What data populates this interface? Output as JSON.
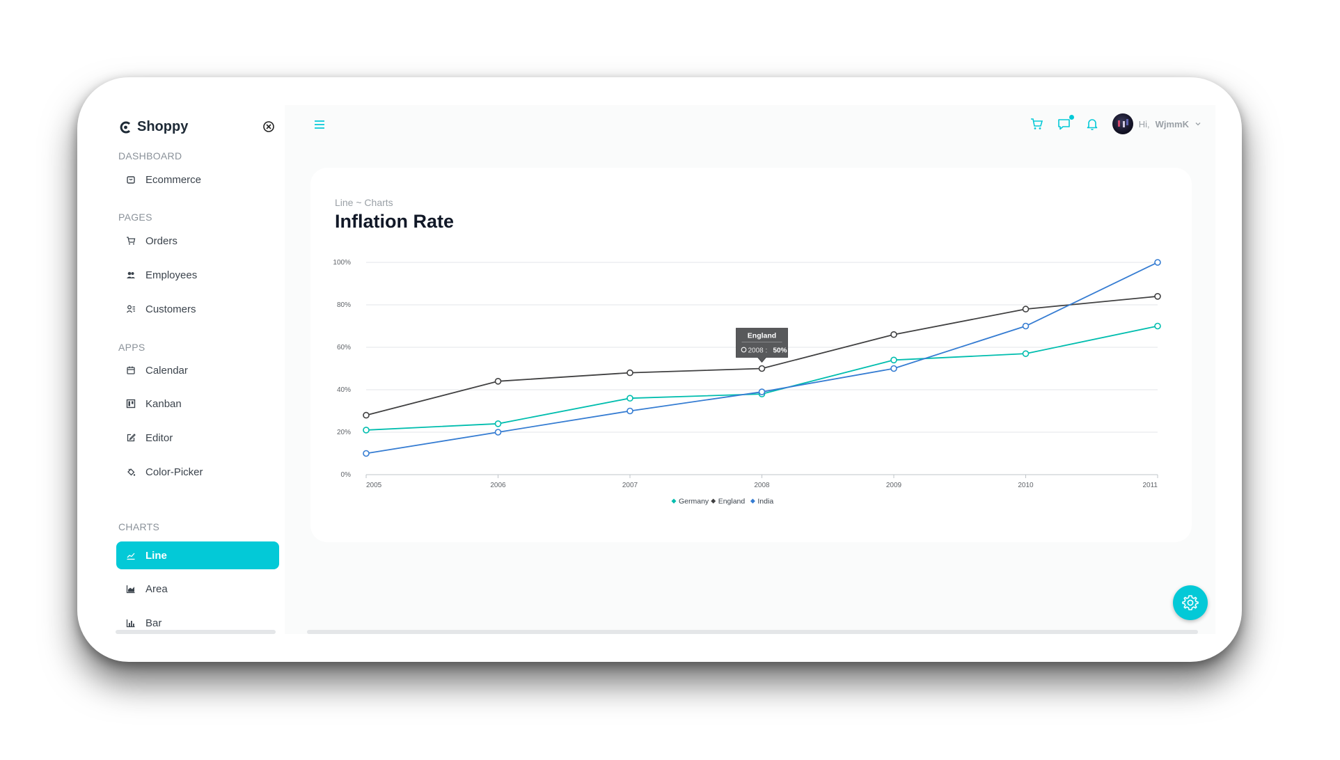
{
  "brand": {
    "name": "Shoppy"
  },
  "sidebar": {
    "sections": [
      {
        "title": "DASHBOARD",
        "items": [
          {
            "label": "Ecommerce",
            "icon": "shopping-bag-icon"
          }
        ]
      },
      {
        "title": "PAGES",
        "items": [
          {
            "label": "Orders",
            "icon": "cart-icon"
          },
          {
            "label": "Employees",
            "icon": "users-icon"
          },
          {
            "label": "Customers",
            "icon": "customers-icon"
          }
        ]
      },
      {
        "title": "APPS",
        "items": [
          {
            "label": "Calendar",
            "icon": "calendar-icon"
          },
          {
            "label": "Kanban",
            "icon": "kanban-icon"
          },
          {
            "label": "Editor",
            "icon": "edit-icon"
          },
          {
            "label": "Color-Picker",
            "icon": "color-picker-icon"
          }
        ]
      },
      {
        "title": "CHARTS",
        "items": [
          {
            "label": "Line",
            "icon": "line-chart-icon",
            "active": true
          },
          {
            "label": "Area",
            "icon": "area-chart-icon"
          },
          {
            "label": "Bar",
            "icon": "bar-chart-icon"
          }
        ]
      }
    ]
  },
  "topbar": {
    "greeting": "Hi,",
    "username": "WjmmK"
  },
  "page": {
    "breadcrumb": "Line ~ Charts",
    "title": "Inflation Rate"
  },
  "colors": {
    "accent": "#03c9d7",
    "germany": "#00bdae",
    "england": "#404041",
    "india": "#357cd2"
  },
  "chart_data": {
    "type": "line",
    "x": [
      "2005",
      "2006",
      "2007",
      "2008",
      "2009",
      "2010",
      "2011"
    ],
    "ylim": [
      0,
      100
    ],
    "yticks": [
      "0%",
      "20%",
      "40%",
      "60%",
      "80%",
      "100%"
    ],
    "grid": true,
    "legend": "bottom-center",
    "series": [
      {
        "name": "Germany",
        "values": [
          21,
          24,
          36,
          38,
          54,
          57,
          70
        ]
      },
      {
        "name": "England",
        "values": [
          28,
          44,
          48,
          50,
          66,
          78,
          84
        ]
      },
      {
        "name": "India",
        "values": [
          10,
          20,
          30,
          39,
          50,
          70,
          100
        ]
      }
    ],
    "tooltip": {
      "series": "England",
      "x": "2008",
      "y": "50%"
    }
  }
}
